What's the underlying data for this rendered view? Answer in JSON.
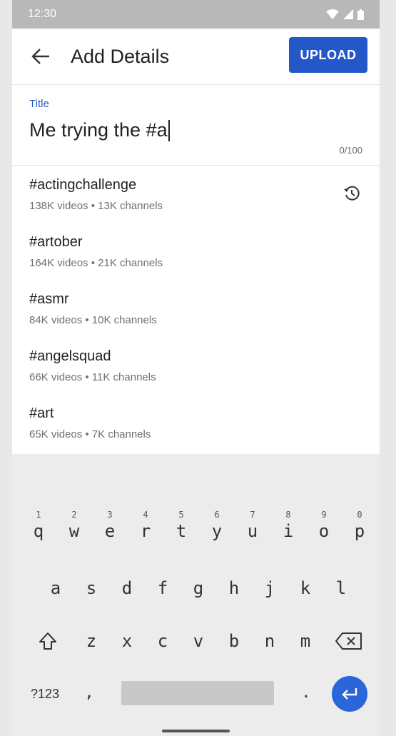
{
  "status_bar": {
    "time": "12:30"
  },
  "app_bar": {
    "title": "Add Details",
    "upload_label": "UPLOAD"
  },
  "title_field": {
    "label": "Title",
    "value": "Me trying the #a",
    "counter": "0/100"
  },
  "suggestions": [
    {
      "tag": "#actingchallenge",
      "meta": "138K videos • 13K channels",
      "history": true
    },
    {
      "tag": "#artober",
      "meta": "164K videos • 21K channels"
    },
    {
      "tag": "#asmr",
      "meta": "84K videos • 10K channels"
    },
    {
      "tag": "#angelsquad",
      "meta": "66K videos • 11K channels"
    },
    {
      "tag": "#art",
      "meta": "65K videos • 7K channels"
    }
  ],
  "keyboard": {
    "row1": [
      {
        "num": "1",
        "ch": "q"
      },
      {
        "num": "2",
        "ch": "w"
      },
      {
        "num": "3",
        "ch": "e"
      },
      {
        "num": "4",
        "ch": "r"
      },
      {
        "num": "5",
        "ch": "t"
      },
      {
        "num": "6",
        "ch": "y"
      },
      {
        "num": "7",
        "ch": "u"
      },
      {
        "num": "8",
        "ch": "i"
      },
      {
        "num": "9",
        "ch": "o"
      },
      {
        "num": "0",
        "ch": "p"
      }
    ],
    "row2": [
      "a",
      "s",
      "d",
      "f",
      "g",
      "h",
      "j",
      "k",
      "l"
    ],
    "row3": [
      "z",
      "x",
      "c",
      "v",
      "b",
      "n",
      "m"
    ],
    "symbols_label": "?123",
    "comma": ",",
    "period": "."
  },
  "colors": {
    "accent": "#2458c8",
    "keyboard_bg": "#ececec",
    "enter_key": "#2a66d9"
  }
}
